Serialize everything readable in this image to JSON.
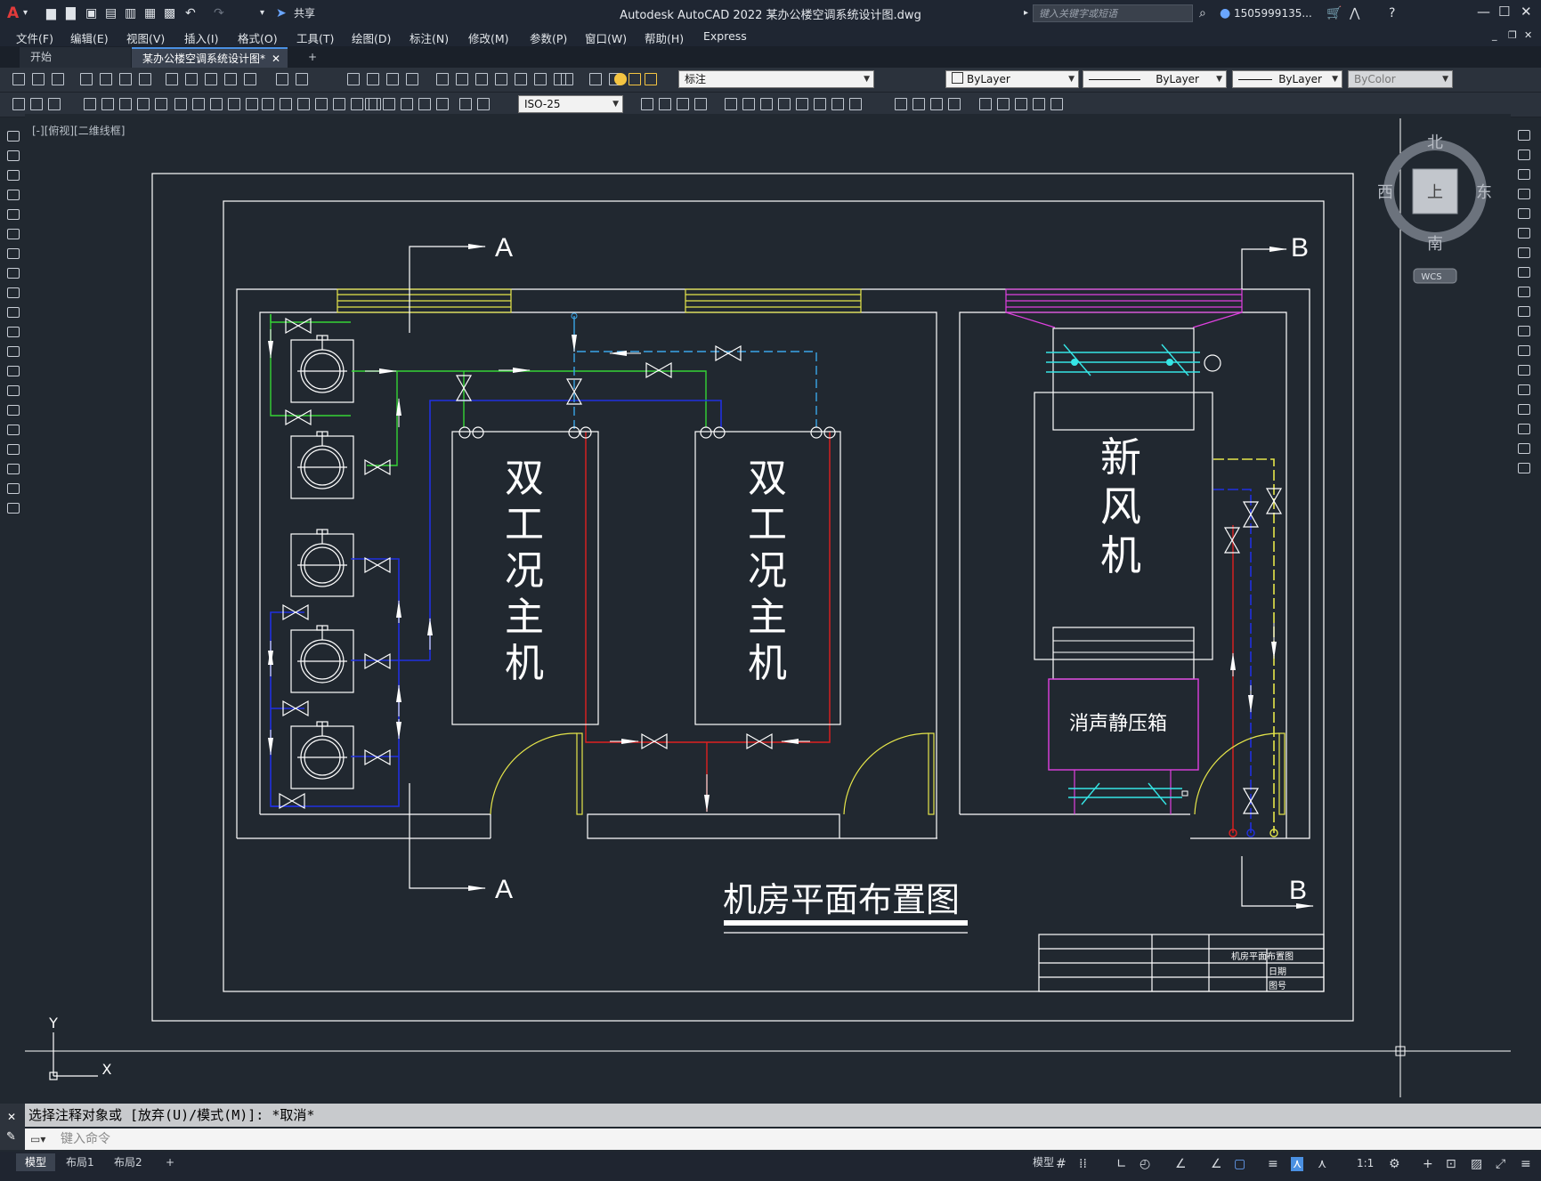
{
  "app": {
    "window_title": "Autodesk AutoCAD 2022    某办公楼空调系统设计图.dwg",
    "share_label": "共享",
    "search_placeholder": "键入关键字或短语",
    "user": "1505999135...",
    "window_controls": [
      "minimize-icon",
      "restore-icon",
      "close-icon"
    ]
  },
  "menu": [
    "文件(F)",
    "编辑(E)",
    "视图(V)",
    "插入(I)",
    "格式(O)",
    "工具(T)",
    "绘图(D)",
    "标注(N)",
    "修改(M)",
    "参数(P)",
    "窗口(W)",
    "帮助(H)",
    "Express"
  ],
  "tabs": {
    "start": "开始",
    "active": "某办公楼空调系统设计图*",
    "add": "+"
  },
  "toolbar1": {
    "layer": "标注",
    "color": "ByLayer",
    "linetype": "ByLayer",
    "lineweight": "ByLayer",
    "plotstyle": "ByColor"
  },
  "toolbar2": {
    "dimstyle": "ISO-25"
  },
  "viewport_label": "[-][俯视][二维线框]",
  "viewcube": {
    "north": "北",
    "south": "南",
    "east": "东",
    "west": "西",
    "face": "上",
    "wcs": "WCS"
  },
  "drawing": {
    "section_a": "A",
    "section_b": "B",
    "unit1_chars": [
      "双",
      "工",
      "况",
      "主",
      "机"
    ],
    "unit2_chars": [
      "双",
      "工",
      "况",
      "主",
      "机"
    ],
    "ahu_chars": [
      "新",
      "风",
      "机"
    ],
    "plenum_label": "消声静压箱",
    "drawing_title": "机房平面布置图",
    "titleblock": {
      "name": "机房平面布置图",
      "date": "日期",
      "number": "图号"
    },
    "ucs_x": "X",
    "ucs_y": "Y"
  },
  "command": {
    "history": "选择注释对象或 [放弃(U)/模式(M)]: *取消*",
    "input_placeholder": "键入命令"
  },
  "layout_tabs": [
    "模型",
    "布局1",
    "布局2"
  ],
  "status": {
    "scale": "1:1"
  }
}
